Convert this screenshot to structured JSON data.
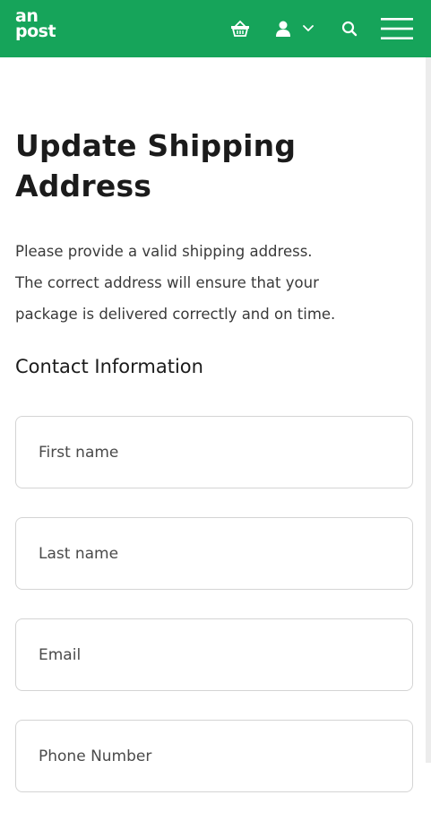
{
  "header": {
    "logo_line1": "an",
    "logo_line2": "post",
    "background_color": "#16a45a",
    "icons": [
      "basket-icon",
      "user-icon",
      "chevron-down-icon",
      "search-icon",
      "hamburger-menu-icon"
    ]
  },
  "page": {
    "title_line1": "Update Shipping",
    "title_line2": "Address",
    "intro_line1": "Please provide a valid shipping address.",
    "intro_line2": "The correct address will ensure that your",
    "intro_line3": "package is delivered correctly and on time.",
    "section_title": "Contact Information"
  },
  "form": {
    "first_name": {
      "placeholder": "First name",
      "value": ""
    },
    "last_name": {
      "placeholder": "Last name",
      "value": ""
    },
    "email": {
      "placeholder": "Email",
      "value": ""
    },
    "phone": {
      "placeholder": "Phone Number",
      "value": ""
    }
  }
}
